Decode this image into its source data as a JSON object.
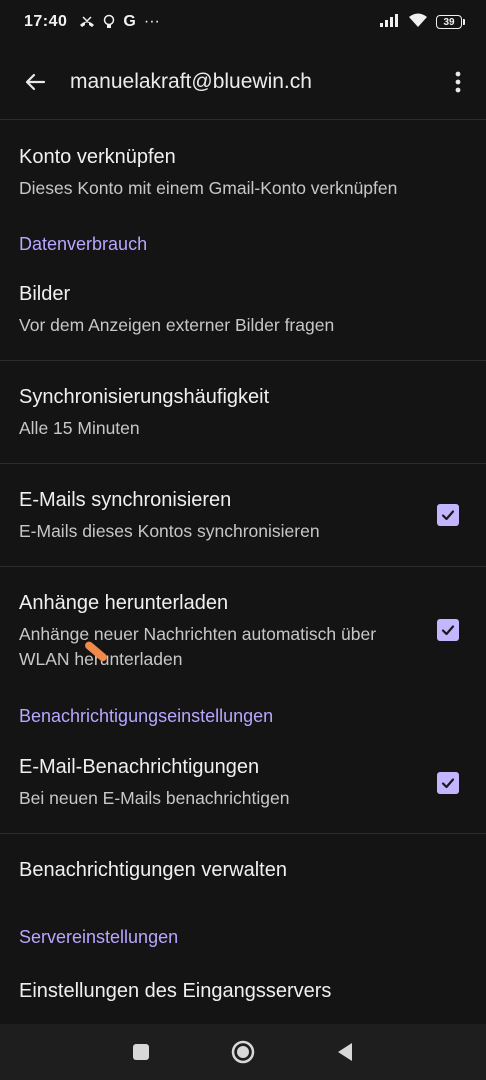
{
  "status_bar": {
    "time": "17:40",
    "g_label": "G",
    "dots": "···",
    "battery": "39"
  },
  "app_bar": {
    "title": "manuelakraft@bluewin.ch"
  },
  "prefs": {
    "link_account": {
      "title": "Konto verknüpfen",
      "subtitle": "Dieses Konto mit einem Gmail-Konto verknüpfen"
    },
    "data_usage_header": "Datenverbrauch",
    "images": {
      "title": "Bilder",
      "subtitle": "Vor dem Anzeigen externer Bilder fragen"
    },
    "sync_frequency": {
      "title": "Synchronisierungshäufigkeit",
      "subtitle": "Alle 15 Minuten"
    },
    "sync_emails": {
      "title": "E-Mails synchronisieren",
      "subtitle": "E-Mails dieses Kontos synchronisieren",
      "checked": true
    },
    "download_attachments": {
      "title": "Anhänge herunterladen",
      "subtitle": "Anhänge neuer Nachrichten automatisch über WLAN herunterladen",
      "checked": true
    },
    "notification_header": "Benachrichtigungseinstellungen",
    "email_notifications": {
      "title": "E-Mail-Benachrichtigungen",
      "subtitle": "Bei neuen E-Mails benachrichtigen",
      "checked": true
    },
    "manage_notifications": {
      "title": "Benachrichtigungen verwalten"
    },
    "server_header": "Servereinstellungen",
    "incoming_server": {
      "title": "Einstellungen des Eingangsservers"
    }
  },
  "icons": {
    "back": "arrow-left-icon",
    "more": "more-vert-icon",
    "checkbox": "check-icon"
  },
  "colors": {
    "accent": "#b9a6ff",
    "checkbox": "#c4b5ff",
    "background": "#141414"
  }
}
